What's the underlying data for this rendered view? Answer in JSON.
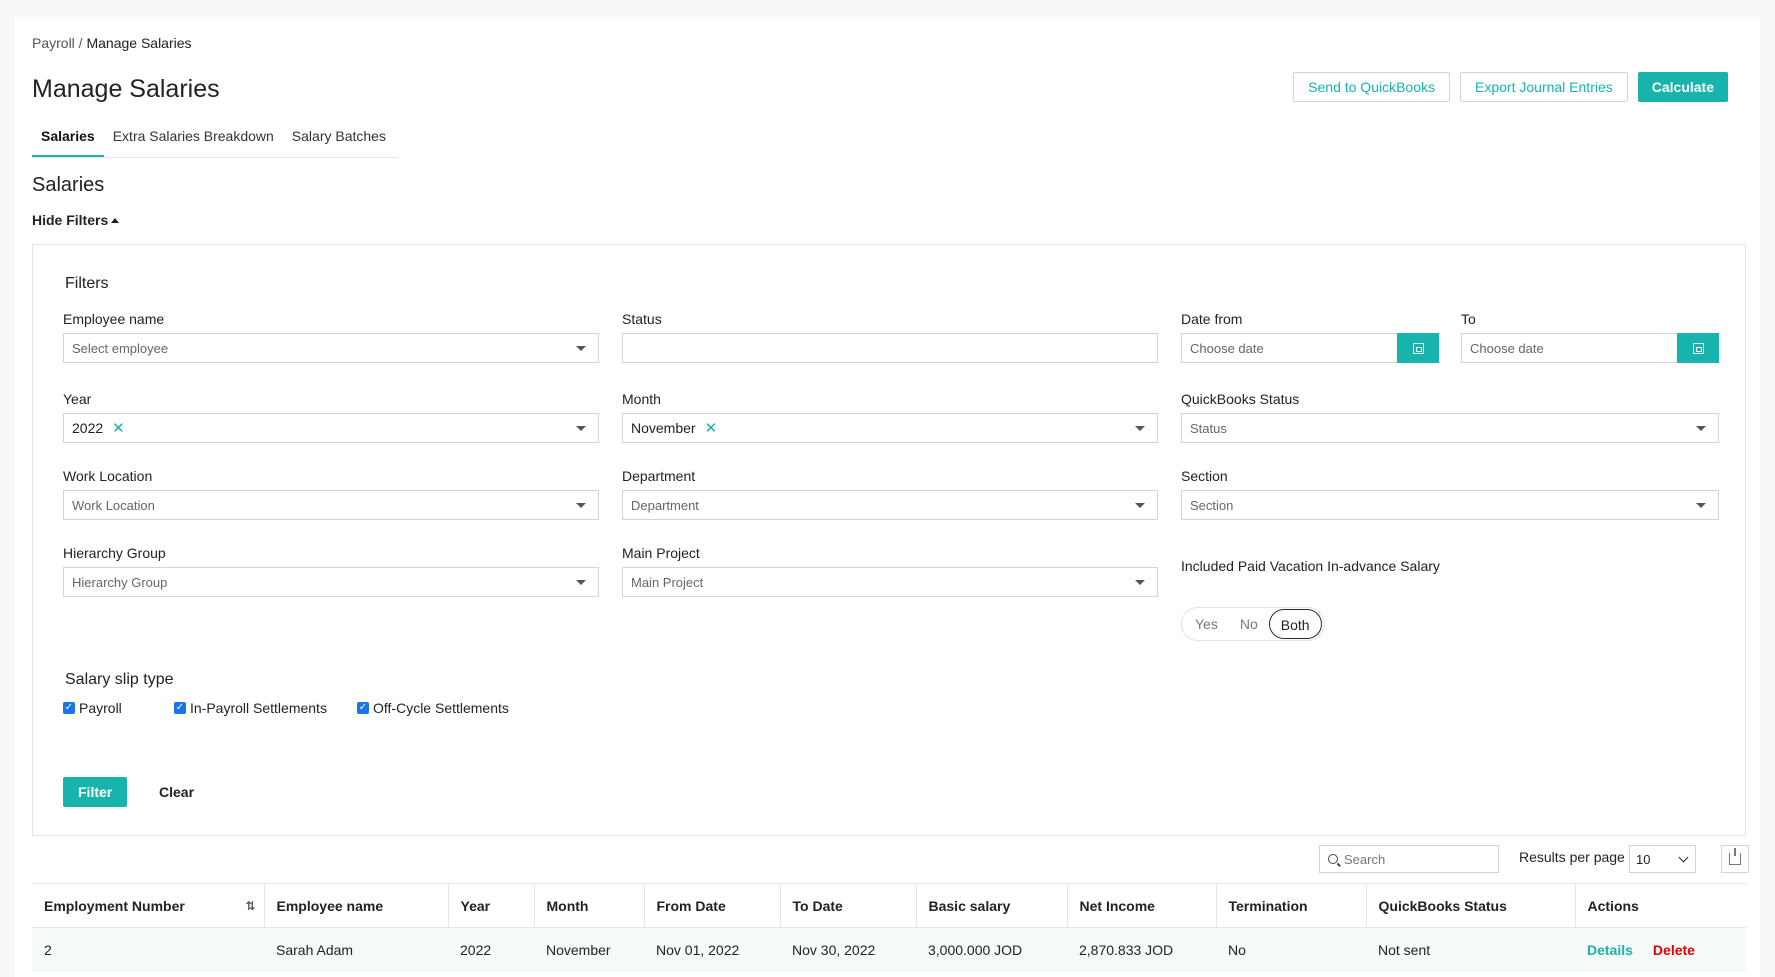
{
  "breadcrumb": {
    "parent": "Payroll",
    "separator": " / ",
    "current": "Manage Salaries"
  },
  "page_title": "Manage Salaries",
  "actions": {
    "send_quickbooks": "Send to QuickBooks",
    "export_journal": "Export Journal Entries",
    "calculate": "Calculate"
  },
  "tabs": [
    {
      "label": "Salaries",
      "active": true
    },
    {
      "label": "Extra Salaries Breakdown",
      "active": false
    },
    {
      "label": "Salary Batches",
      "active": false
    }
  ],
  "section_title": "Salaries",
  "hide_filters": "Hide Filters",
  "filters": {
    "title": "Filters",
    "employee": {
      "label": "Employee name",
      "placeholder": "Select employee"
    },
    "status": {
      "label": "Status",
      "value": ""
    },
    "date_from": {
      "label": "Date from",
      "placeholder": "Choose date"
    },
    "date_to": {
      "label": "To",
      "placeholder": "Choose date"
    },
    "year": {
      "label": "Year",
      "value": "2022"
    },
    "month": {
      "label": "Month",
      "value": "November"
    },
    "qb_status": {
      "label": "QuickBooks Status",
      "placeholder": "Status"
    },
    "work_location": {
      "label": "Work Location",
      "placeholder": "Work Location"
    },
    "department": {
      "label": "Department",
      "placeholder": "Department"
    },
    "section": {
      "label": "Section",
      "placeholder": "Section"
    },
    "hierarchy": {
      "label": "Hierarchy Group",
      "placeholder": "Hierarchy Group"
    },
    "main_project": {
      "label": "Main Project",
      "placeholder": "Main Project"
    },
    "paid_vacation": {
      "label": "Included Paid Vacation In-advance Salary",
      "options": [
        "Yes",
        "No",
        "Both"
      ],
      "selected": "Both"
    },
    "slip_type": {
      "label": "Salary slip type",
      "options": [
        "Payroll",
        "In-Payroll Settlements",
        "Off-Cycle Settlements"
      ]
    },
    "filter_btn": "Filter",
    "clear_btn": "Clear"
  },
  "table_tools": {
    "search_placeholder": "Search",
    "results_per_page_label": "Results per page",
    "results_per_page": "10"
  },
  "table": {
    "columns": [
      "Employment Number",
      "Employee name",
      "Year",
      "Month",
      "From Date",
      "To Date",
      "Basic salary",
      "Net Income",
      "Termination",
      "QuickBooks Status",
      "Actions"
    ],
    "rows": [
      [
        "2",
        "Sarah Adam",
        "2022",
        "November",
        "Nov 01, 2022",
        "Nov 30, 2022",
        "3,000.000 JOD",
        "2,870.833 JOD",
        "No",
        "Not sent"
      ]
    ],
    "row_actions": {
      "details": "Details",
      "delete": "Delete"
    }
  },
  "colors": {
    "accent": "#17b3ac",
    "danger": "#e00000"
  },
  "icons": {
    "sort": "sort-icon",
    "calendar": "calendar-icon",
    "search": "search-icon",
    "export": "export-icon",
    "chevron": "chevron-down-icon",
    "clear": "close-icon"
  }
}
